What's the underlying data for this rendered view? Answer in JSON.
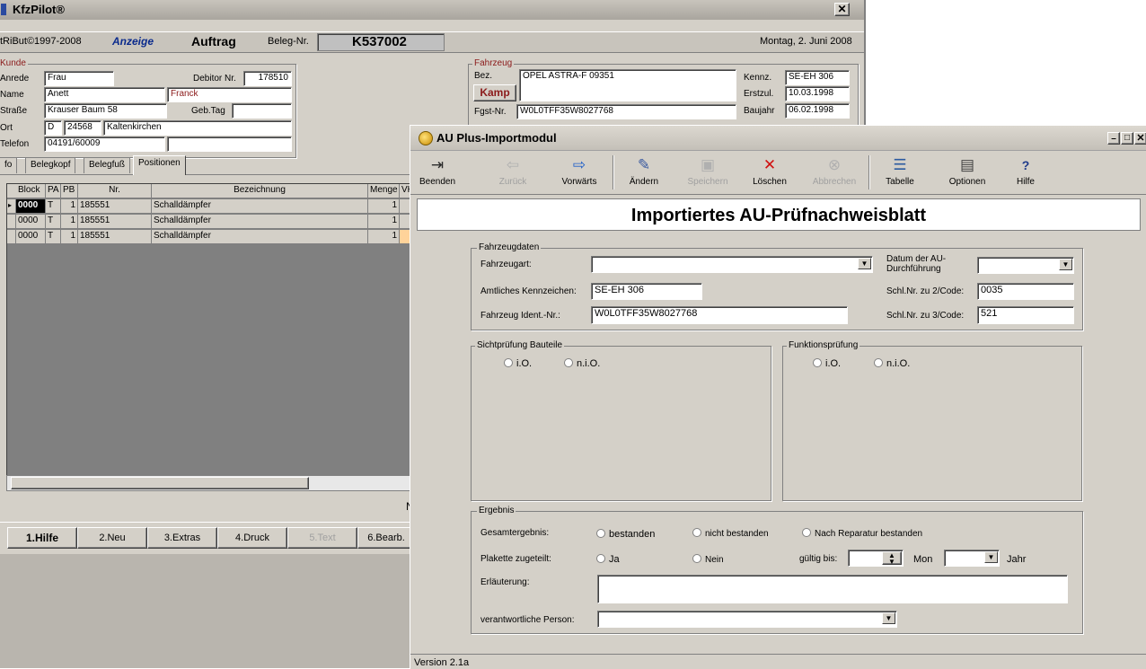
{
  "bg": {
    "title": "KfzPilot®",
    "copyright": "tRiBut©1997-2008",
    "mode": "Anzeige",
    "doc_type": "Auftrag",
    "beleg_label": "Beleg-Nr.",
    "beleg_no": "K537002",
    "date": "Montag, 2. Juni 2008",
    "kunde": {
      "legend": "Kunde",
      "anrede_label": "Anrede",
      "anrede": "Frau",
      "debitor_label": "Debitor Nr.",
      "debitor": "178510",
      "name_label": "Name",
      "vorname": "Anett",
      "nachname": "Franck",
      "strasse_label": "Straße",
      "strasse": "Krauser Baum 58",
      "gebtag_label": "Geb.Tag",
      "ort_label": "Ort",
      "land": "D",
      "plz": "24568",
      "ort": "Kaltenkirchen",
      "telefon_label": "Telefon",
      "telefon": "04191/60009"
    },
    "fahrzeug": {
      "legend": "Fahrzeug",
      "bez_label": "Bez.",
      "bez": "OPEL ASTRA-F 09351",
      "make_button": "Kamp",
      "fgst_label": "Fgst-Nr.",
      "fgst": "W0L0TFF35W8027768",
      "kennz_label": "Kennz.",
      "kennz": "SE-EH 306",
      "erstzul_label": "Erstzul.",
      "erstzul": "10.03.1998",
      "baujahr_label": "Baujahr",
      "baujahr": "06.02.1998"
    },
    "tabs": [
      "fo",
      "Belegkopf",
      "Belegfuß",
      "Positionen"
    ],
    "table": {
      "headers": [
        "Block",
        "PA",
        "PB",
        "Nr.",
        "Bezeichnung",
        "Menge",
        "VK"
      ],
      "rows": [
        [
          "0000",
          "T",
          "1",
          "185551",
          "Schalldämpfer",
          "1"
        ],
        [
          "0000",
          "T",
          "1",
          "185551",
          "Schalldämpfer",
          "1"
        ],
        [
          "0000",
          "T",
          "1",
          "185551",
          "Schalldämpfer",
          "1"
        ]
      ]
    },
    "status_char": "N",
    "fkeys": [
      "1.Hilfe",
      "2.Neu",
      "3.Extras",
      "4.Druck",
      "5.Text",
      "6.Bearb."
    ]
  },
  "au": {
    "title": "AU Plus-Importmodul",
    "toolbar": [
      {
        "label": "Beenden",
        "icon": "exit-icon",
        "glyph": "⇥",
        "enabled": true
      },
      {
        "label": "Zurück",
        "icon": "arrow-left-icon",
        "glyph": "⇦",
        "enabled": false
      },
      {
        "label": "Vorwärts",
        "icon": "arrow-right-icon",
        "glyph": "⇨",
        "enabled": true
      },
      {
        "label": "Ändern",
        "icon": "edit-icon",
        "glyph": "✎",
        "enabled": true
      },
      {
        "label": "Speichern",
        "icon": "save-icon",
        "glyph": "▣",
        "enabled": false
      },
      {
        "label": "Löschen",
        "icon": "delete-icon",
        "glyph": "✕",
        "enabled": true
      },
      {
        "label": "Abbrechen",
        "icon": "cancel-icon",
        "glyph": "⊗",
        "enabled": false
      },
      {
        "label": "Tabelle",
        "icon": "table-icon",
        "glyph": "☰",
        "enabled": true
      },
      {
        "label": "Optionen",
        "icon": "options-icon",
        "glyph": "▤",
        "enabled": true
      },
      {
        "label": "Hilfe",
        "icon": "help-icon",
        "glyph": "?",
        "enabled": true
      }
    ],
    "heading": "Importiertes AU-Prüfnachweisblatt",
    "fahrzeugdaten": {
      "legend": "Fahrzeugdaten",
      "fahrzeugart_label": "Fahrzeugart:",
      "fahrzeugart": "",
      "kennzeichen_label": "Amtliches Kennzeichen:",
      "kennzeichen": "SE-EH 306",
      "ident_label": "Fahrzeug Ident.-Nr.:",
      "ident": "W0L0TFF35W8027768",
      "datum_label_1": "Datum der AU-",
      "datum_label_2": "Durchführung",
      "datum": "",
      "schl2_label": "Schl.Nr. zu 2/Code:",
      "schl2": "0035",
      "schl3_label": "Schl.Nr. zu 3/Code:",
      "schl3": "521"
    },
    "sicht": {
      "legend": "Sichtprüfung Bauteile",
      "io": "i.O.",
      "nio": "n.i.O."
    },
    "funktion": {
      "legend": "Funktionsprüfung",
      "io": "i.O.",
      "nio": "n.i.O."
    },
    "ergebnis": {
      "legend": "Ergebnis",
      "gesamt_label": "Gesamtergebnis:",
      "bestanden": "bestanden",
      "nicht_bestanden": "nicht bestanden",
      "nach_reparatur": "Nach Reparatur bestanden",
      "plakette_label": "Plakette zugeteilt:",
      "ja": "Ja",
      "nein": "Nein",
      "gueltig_label": "gültig bis:",
      "mon_label": "Mon",
      "jahr_label": "Jahr",
      "erlaeuterung_label": "Erläuterung:",
      "erlaeuterung": "",
      "person_label": "verantwortliche Person:",
      "person": ""
    },
    "status": "Version 2.1a"
  },
  "colors": {
    "window_bg": "#d4d0c8",
    "title_bg": "#b9b5ae",
    "grid_bg": "#808080",
    "accent_red": "#8b1a1a",
    "label_blue": "#0a2a8c"
  }
}
